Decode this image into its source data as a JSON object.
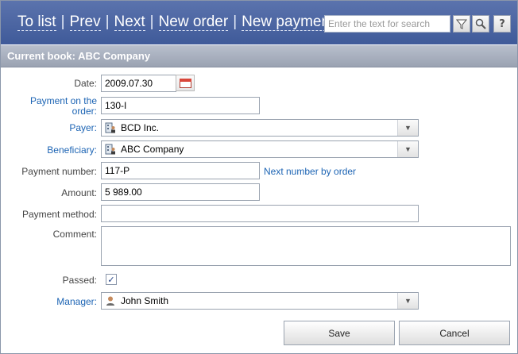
{
  "nav": {
    "to_list": "To list",
    "prev": "Prev",
    "next": "Next",
    "new_order": "New order",
    "new_payment": "New payment",
    "separator": "|"
  },
  "search": {
    "placeholder": "Enter the text for search"
  },
  "toolbar_icons": {
    "filter": "filter-icon",
    "find": "magnifier-icon",
    "help": "?"
  },
  "section": {
    "title": "Current book: ABC Company"
  },
  "form": {
    "date": {
      "label": "Date:",
      "value": "2009.07.30"
    },
    "payment_on_order": {
      "label": "Payment on the order:",
      "value": "130-I"
    },
    "payer": {
      "label": "Payer:",
      "value": "BCD Inc."
    },
    "beneficiary": {
      "label": "Beneficiary:",
      "value": "ABC Company"
    },
    "payment_number": {
      "label": "Payment number:",
      "value": "117-P",
      "link": "Next number by order"
    },
    "amount": {
      "label": "Amount:",
      "value": "5 989.00"
    },
    "payment_method": {
      "label": "Payment method:",
      "value": ""
    },
    "comment": {
      "label": "Comment:",
      "value": ""
    },
    "passed": {
      "label": "Passed:",
      "checked": true
    },
    "manager": {
      "label": "Manager:",
      "value": "John Smith"
    }
  },
  "buttons": {
    "save": "Save",
    "cancel": "Cancel"
  },
  "colors": {
    "header_top": "#5b73ad",
    "header_bottom": "#3f5a99",
    "link": "#1c64b4",
    "section": "#9aa2b2"
  }
}
